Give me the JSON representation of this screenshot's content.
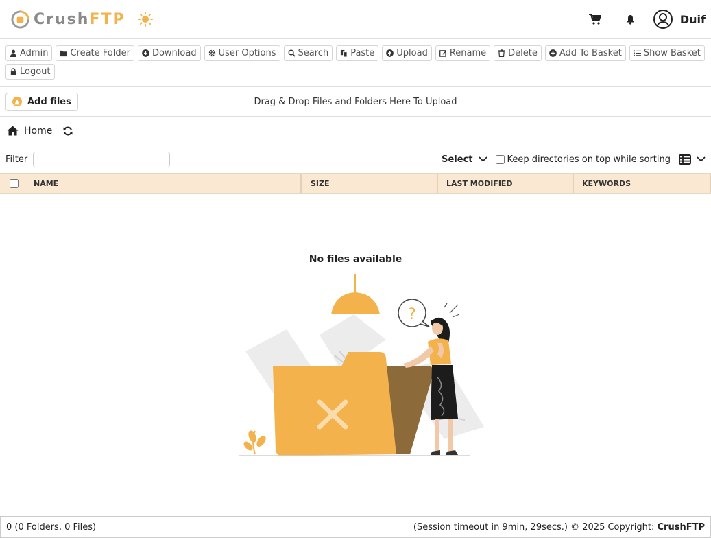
{
  "header": {
    "logo": {
      "part1": "Crush",
      "part2": "FTP"
    },
    "user_name": "Duif",
    "icons": [
      "sun-icon",
      "cart-icon",
      "bell-icon",
      "user-circle-icon"
    ]
  },
  "toolbar": {
    "buttons": [
      {
        "label": "Admin",
        "icon": "user-icon"
      },
      {
        "label": "Create Folder",
        "icon": "folder-icon"
      },
      {
        "label": "Download",
        "icon": "download-icon"
      },
      {
        "label": "User Options",
        "icon": "gear-icon"
      },
      {
        "label": "Search",
        "icon": "search-icon"
      },
      {
        "label": "Paste",
        "icon": "paste-icon"
      },
      {
        "label": "Upload",
        "icon": "upload-icon"
      },
      {
        "label": "Rename",
        "icon": "edit-icon"
      },
      {
        "label": "Delete",
        "icon": "trash-icon"
      },
      {
        "label": "Add To Basket",
        "icon": "plus-circle-icon"
      },
      {
        "label": "Show Basket",
        "icon": "list-icon"
      },
      {
        "label": "Logout",
        "icon": "lock-icon"
      }
    ]
  },
  "upload": {
    "add_files_label": "Add files",
    "drop_text": "Drag & Drop Files and Folders Here To Upload"
  },
  "breadcrumb": {
    "home_label": "Home"
  },
  "filter": {
    "label": "Filter",
    "value": "",
    "select_label": "Select",
    "keep_dirs_label": "Keep directories on top while sorting",
    "keep_dirs_checked": false
  },
  "table": {
    "columns": [
      "NAME",
      "SIZE",
      "LAST MODIFIED",
      "KEYWORDS"
    ],
    "rows": [],
    "empty_text": "No files available"
  },
  "footer": {
    "count_text": "0 (0 Folders, 0 Files)",
    "session_text": "(Session timeout in 9min, 29secs.) © 2025 Copyright:",
    "brand": "CrushFTP"
  },
  "colors": {
    "accent": "#f4b24c",
    "header_row": "#fbe8d2",
    "folder_dark": "#8c6a3a"
  }
}
